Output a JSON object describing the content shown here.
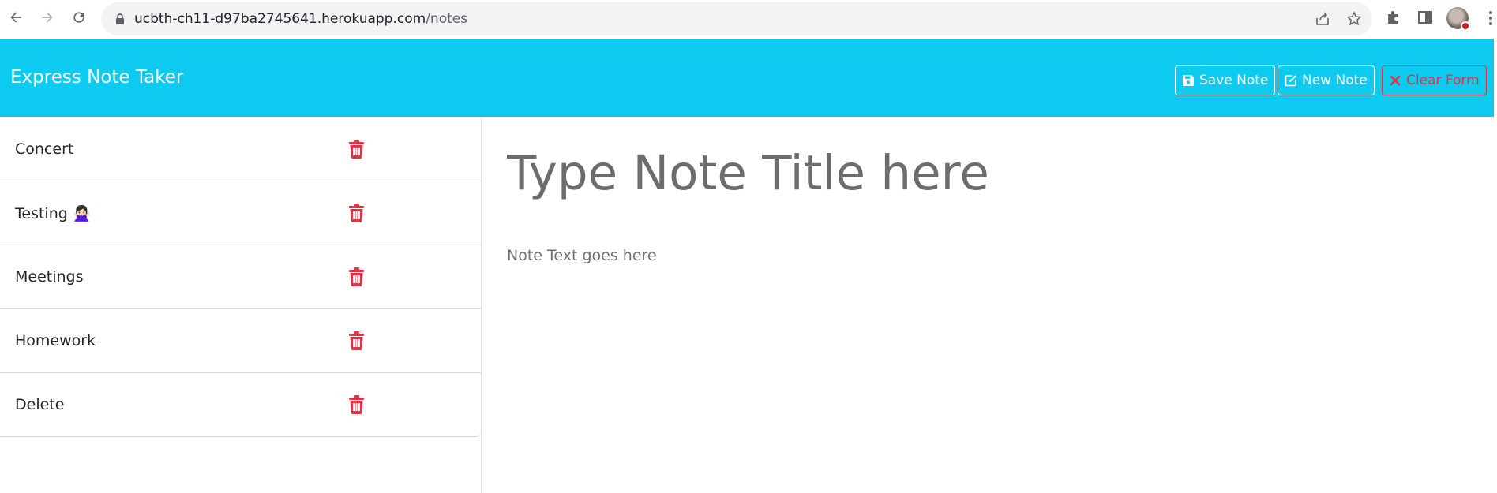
{
  "browser": {
    "url_host": "ucbth-ch11-d97ba2745641.herokuapp.com",
    "url_path": "/notes",
    "icons": [
      "back-arrow-icon",
      "forward-arrow-icon",
      "reload-icon",
      "lock-icon",
      "share-icon",
      "star-icon",
      "extensions-puzzle-icon",
      "side-panel-icon",
      "profile-avatar",
      "more-vert-icon"
    ]
  },
  "app": {
    "title": "Express Note Taker",
    "accent_color": "#0dcaf0",
    "danger_color": "#dc3545",
    "buttons": {
      "save": "Save Note",
      "new": "New Note",
      "clear": "Clear Form"
    }
  },
  "notes": [
    {
      "title": "Concert"
    },
    {
      "title": "Testing 🙅🏻‍♀️"
    },
    {
      "title": "Meetings"
    },
    {
      "title": "Homework"
    },
    {
      "title": "Delete"
    }
  ],
  "editor": {
    "title_placeholder": "Type Note Title here",
    "text_placeholder": "Note Text goes here"
  }
}
